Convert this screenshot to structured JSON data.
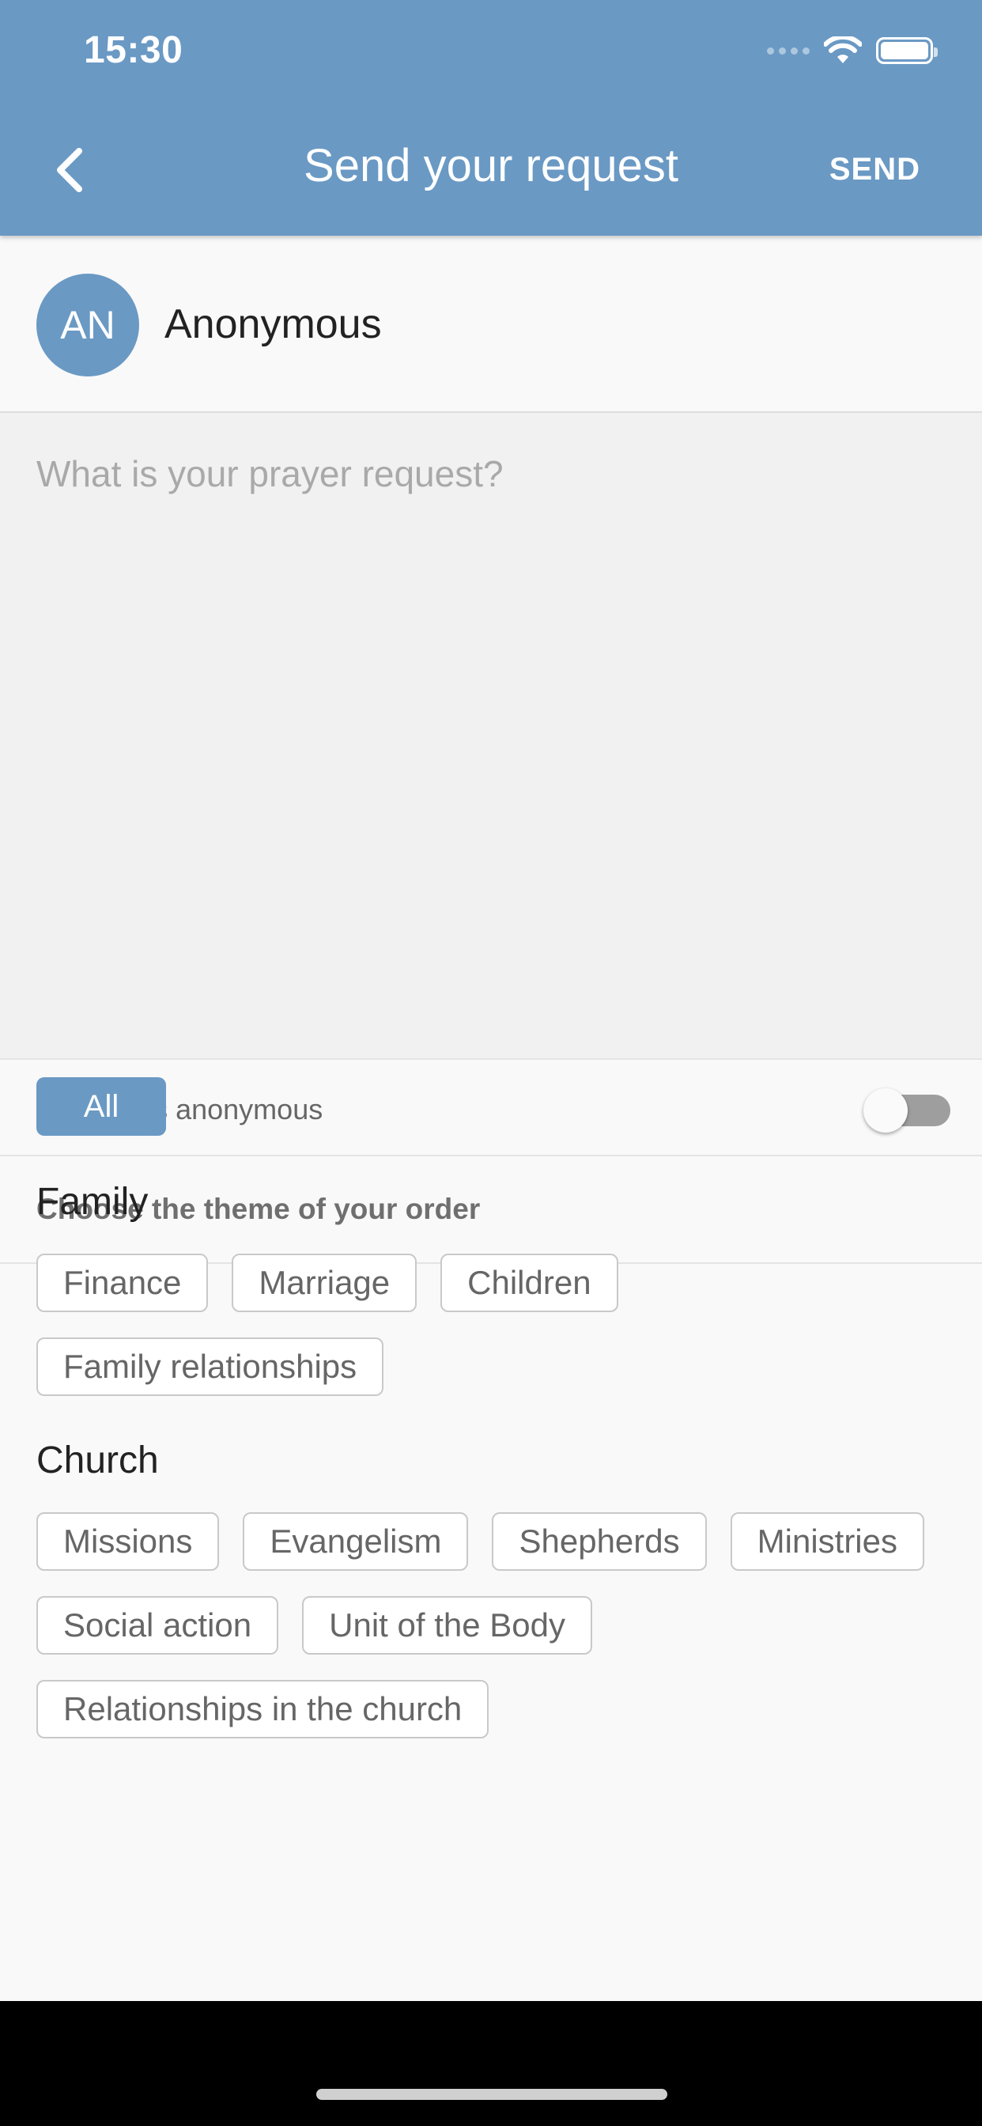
{
  "status_bar": {
    "time": "15:30",
    "icons": [
      "cellular-signal-icon",
      "wifi-icon",
      "battery-icon"
    ]
  },
  "header": {
    "back_icon": "chevron-left-icon",
    "title": "Send your request",
    "send_label": "SEND"
  },
  "user": {
    "initials": "AN",
    "name": "Anonymous"
  },
  "request": {
    "value": "",
    "placeholder": "What is your prayer request?"
  },
  "anonymous": {
    "label": "Publish as anonymous",
    "enabled": false
  },
  "themes": {
    "heading": "Choose the theme of your order",
    "all_label": "All",
    "groups": [
      {
        "title": "Family",
        "items": [
          "Finance",
          "Marriage",
          "Children",
          "Family relationships"
        ]
      },
      {
        "title": "Church",
        "items": [
          "Missions",
          "Evangelism",
          "Shepherds",
          "Ministries",
          "Social action",
          "Unit of the Body",
          "Relationships in the church"
        ]
      }
    ]
  },
  "colors": {
    "accent": "#6a99c4",
    "background": "#f9f9f9",
    "input_background": "#f1f1f1"
  }
}
